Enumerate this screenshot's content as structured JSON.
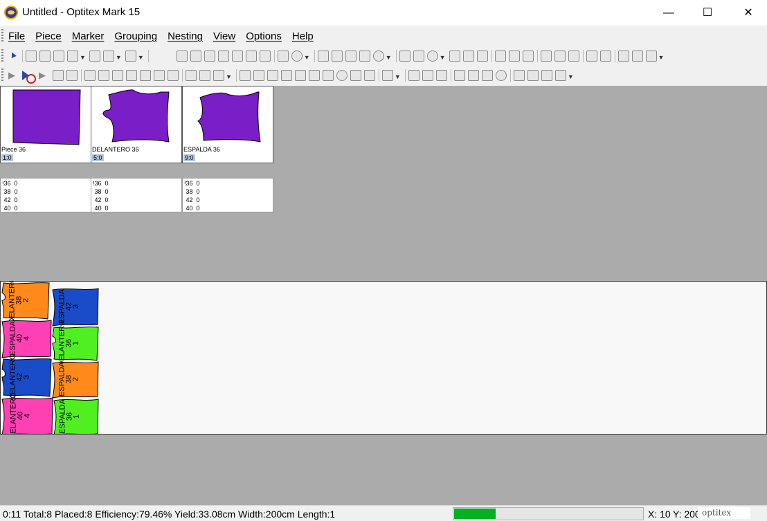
{
  "window": {
    "title": "Untitled - Optitex Mark 15",
    "minimize_glyph": "—",
    "maximize_glyph": "☐",
    "close_glyph": "✕"
  },
  "menu": {
    "items": [
      "File",
      "Piece",
      "Marker",
      "Grouping",
      "Nesting",
      "View",
      "Options",
      "Help"
    ]
  },
  "pieces": [
    {
      "name": "Piece 36",
      "code": "1:0",
      "color": "#7a1ec8"
    },
    {
      "name": "DELANTERO 36",
      "code": "5:0",
      "color": "#7a1ec8"
    },
    {
      "name": "ESPALDA 36",
      "code": "9:0",
      "color": "#7a1ec8"
    }
  ],
  "size_tables": [
    [
      "!36  0",
      " 38  0",
      " 42  0",
      " 40  0"
    ],
    [
      "!36  0",
      " 38  0",
      " 42  0",
      " 40  0"
    ],
    [
      "!36  0",
      " 38  0",
      " 42  0",
      " 40  0"
    ]
  ],
  "marker_pieces": [
    {
      "label": "DELANTERO",
      "size": "38",
      "qty": "2",
      "color": "#ff8a1a"
    },
    {
      "label": "ESPALDA",
      "size": "42",
      "qty": "3",
      "color": "#1a4bc8"
    },
    {
      "label": "ESPALDA",
      "size": "40",
      "qty": "4",
      "color": "#ff40b4"
    },
    {
      "label": "DELANTERO",
      "size": "36",
      "qty": "1",
      "color": "#50f020"
    },
    {
      "label": "DELANTERO",
      "size": "42",
      "qty": "3",
      "color": "#1a4bc8"
    },
    {
      "label": "ESPALDA",
      "size": "38",
      "qty": "2",
      "color": "#ff8a1a"
    },
    {
      "label": "DELANTERO",
      "size": "40",
      "qty": "4",
      "color": "#ff40b4"
    },
    {
      "label": "ESPALDA",
      "size": "36",
      "qty": "1",
      "color": "#50f020"
    }
  ],
  "status": {
    "text": "0:11  Total:8  Placed:8  Efficiency:79.46%  Yield:33.08cm  Width:200cm  Length:1",
    "progress": 0.22,
    "x_label": "X: 10",
    "y_label": "Y: 200",
    "brand": "optitex",
    "progress_color": "#06b025"
  }
}
